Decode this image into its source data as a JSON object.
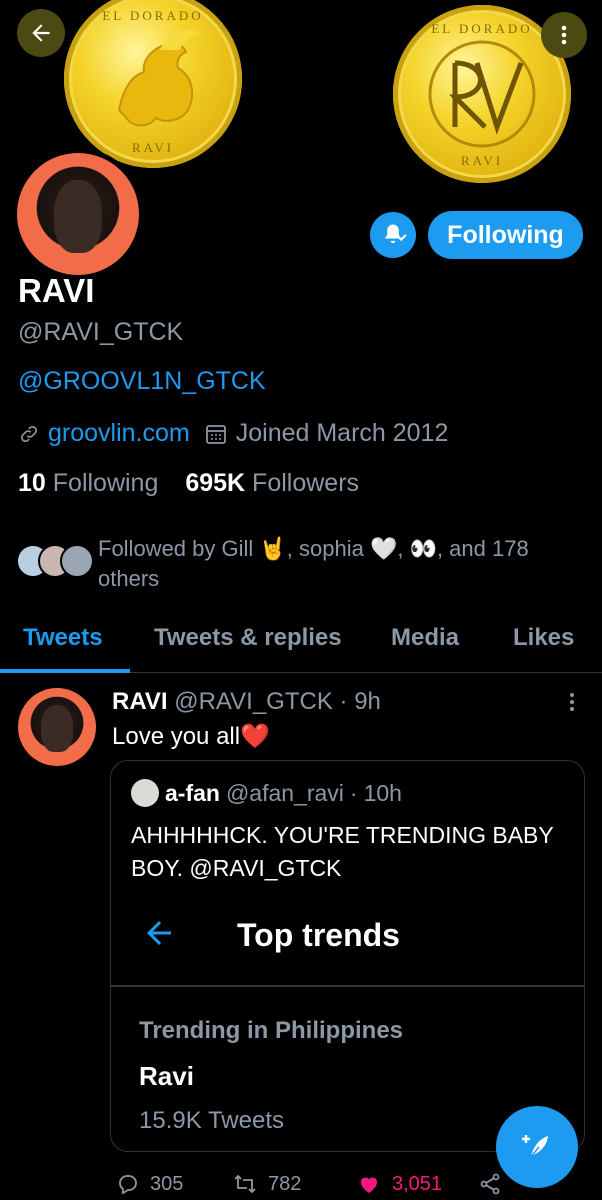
{
  "header": {
    "coin_left": {
      "top_text": "EL DORADO",
      "bottom_text": "RAVI"
    },
    "coin_right": {
      "top_text": "EL DORADO",
      "bottom_text": "RAVI"
    }
  },
  "profile": {
    "name": "RAVI",
    "handle": "@RAVI_GTCK",
    "bio": "@GROOVL1N_GTCK",
    "website": "groovlin.com",
    "joined": "Joined March 2012",
    "following_count": "10",
    "following_label": "Following",
    "followers_count": "695K",
    "followers_label": "Followers",
    "follow_button": "Following",
    "followed_by": "Followed by Gill 🤘, sophia 🤍, 👀, and 178 others"
  },
  "tabs": [
    {
      "label": "Tweets",
      "active": true
    },
    {
      "label": "Tweets & replies",
      "active": false
    },
    {
      "label": "Media",
      "active": false
    },
    {
      "label": "Likes",
      "active": false
    }
  ],
  "tweet": {
    "name": "RAVI",
    "handle": "@RAVI_GTCK",
    "sep": "·",
    "time": "9h",
    "text": "Love you all❤️",
    "quote": {
      "name": "a-fan",
      "handle": "@afan_ravi",
      "sep": "·",
      "time": "10h",
      "text": "AHHHHHCK. YOU'RE TRENDING BABY BOY. @RAVI_GTCK",
      "card": {
        "title": "Top trends",
        "context": "Trending in Philippines",
        "trend": "Ravi",
        "count": "15.9K Tweets"
      }
    },
    "replies": "305",
    "retweets": "782",
    "likes": "3,051"
  },
  "colors": {
    "accent": "#1d9bf0",
    "like": "#f91880",
    "secondary_text": "#8b98a5",
    "background": "#000000"
  }
}
